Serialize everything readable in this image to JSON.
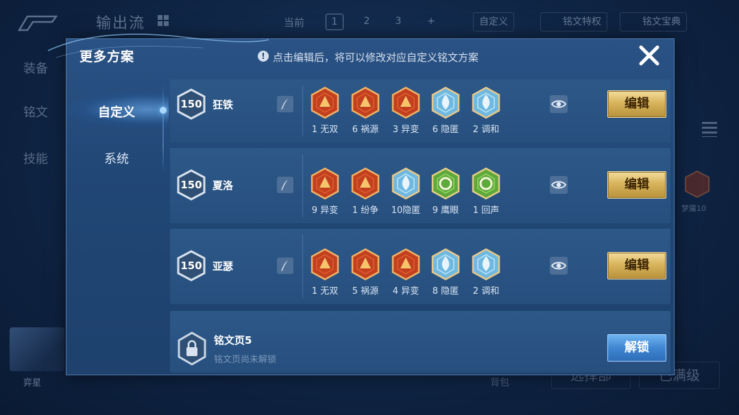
{
  "background": {
    "title": "输出流",
    "current_label": "当前",
    "pages": [
      "1",
      "2",
      "3",
      "+"
    ],
    "custom_label": "自定义",
    "privilege_label": "铭文特权",
    "treasury_label": "铭文宝典",
    "side_items": [
      "装备",
      "铭文",
      "技能"
    ],
    "rune_label": "梦魇10",
    "hero_name": "弈星",
    "bag_label": "背包",
    "select_label": "选择部",
    "full_level_label": "已满级"
  },
  "modal": {
    "title": "更多方案",
    "info_text": "点击编辑后，将可以修改对应自定义铭文方案",
    "close_icon": "close-icon"
  },
  "nav": {
    "items": [
      {
        "label": "自定义",
        "active": true
      },
      {
        "label": "系统",
        "active": false
      }
    ]
  },
  "rows": [
    {
      "level": "150",
      "name": "狂铁",
      "runes": [
        {
          "count": "1",
          "name": "无双",
          "color": "red",
          "icon": "rune-wushuang-icon"
        },
        {
          "count": "6",
          "name": "祸源",
          "color": "red",
          "icon": "rune-huoyuan-icon"
        },
        {
          "count": "3",
          "name": "异变",
          "color": "red",
          "icon": "rune-yibian-icon"
        },
        {
          "count": "6",
          "name": "隐匿",
          "color": "blue",
          "icon": "rune-yinni-icon"
        },
        {
          "count": "2",
          "name": "调和",
          "color": "blue",
          "icon": "rune-tiaohe-icon"
        }
      ],
      "labels": [
        "1 无双",
        "6 祸源",
        "3 异变",
        "6 隐匿",
        "2 调和"
      ],
      "button": "编辑"
    },
    {
      "level": "150",
      "name": "夏洛",
      "runes": [
        {
          "count": "9",
          "name": "异变",
          "color": "red",
          "icon": "rune-yibian-icon"
        },
        {
          "count": "1",
          "name": "纷争",
          "color": "red",
          "icon": "rune-fenzheng-icon"
        },
        {
          "count": "10",
          "name": "隐匿",
          "color": "blue",
          "icon": "rune-yinni-icon"
        },
        {
          "count": "9",
          "name": "鹰眼",
          "color": "green",
          "icon": "rune-yingyan-icon"
        },
        {
          "count": "1",
          "name": "回声",
          "color": "green",
          "icon": "rune-huisheng-icon"
        }
      ],
      "labels": [
        "9 异变",
        "1 纷争",
        "10隐匿",
        "9 鹰眼",
        "1 回声"
      ],
      "button": "编辑"
    },
    {
      "level": "150",
      "name": "亚瑟",
      "runes": [
        {
          "count": "1",
          "name": "无双",
          "color": "red",
          "icon": "rune-wushuang-icon"
        },
        {
          "count": "5",
          "name": "祸源",
          "color": "red",
          "icon": "rune-huoyuan-icon"
        },
        {
          "count": "4",
          "name": "异变",
          "color": "red",
          "icon": "rune-yibian-icon"
        },
        {
          "count": "8",
          "name": "隐匿",
          "color": "blue",
          "icon": "rune-yinni-icon"
        },
        {
          "count": "2",
          "name": "调和",
          "color": "blue",
          "icon": "rune-tiaohe-icon"
        }
      ],
      "labels": [
        "1 无双",
        "5 祸源",
        "4 异变",
        "8 隐匿",
        "2 调和"
      ],
      "button": "编辑"
    }
  ],
  "locked_row": {
    "title": "铭文页5",
    "subtitle": "铭文页尚未解锁",
    "button": "解锁"
  },
  "colors": {
    "gold_button": "#d8b45c",
    "blue_button": "#3f86d2",
    "rune_red": "#c2401f",
    "rune_blue": "#8fd2ef",
    "rune_green": "#6cc04a"
  }
}
